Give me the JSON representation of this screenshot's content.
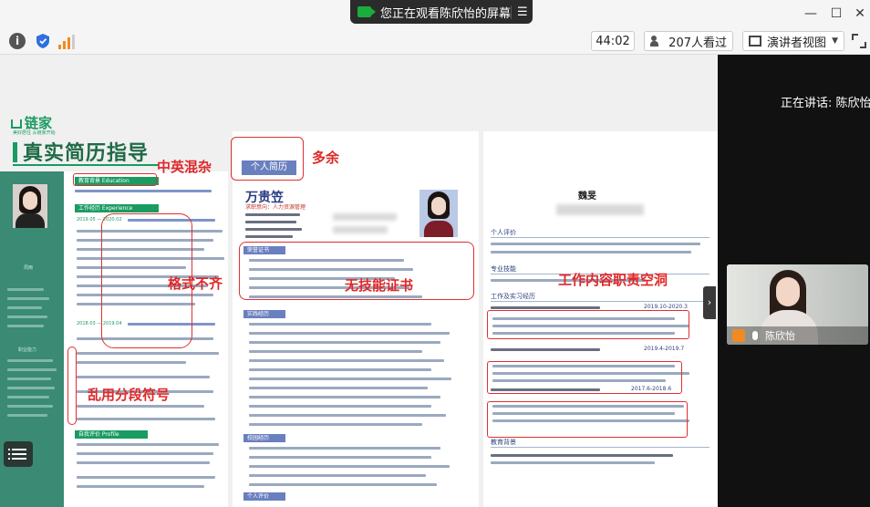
{
  "titlebar": {
    "share_status": "您正在观看陈欣怡的屏幕",
    "menu_glyph": "☰",
    "minimize_glyph": "—",
    "maximize_glyph": "☐",
    "close_glyph": "✕"
  },
  "toolbar": {
    "info_glyph": "i",
    "timer": "44:02",
    "viewers": "207人看过",
    "view_mode": "演讲者视图",
    "view_chevron": "▼"
  },
  "speaker": {
    "label": "正在讲话: 陈欣怡;",
    "camera_name": "陈欣怡"
  },
  "document": {
    "brand": "链家",
    "brand_sub": "美好居住 从链家开始",
    "title": "真实简历指导",
    "left_resume": {
      "section_education": "教育背景  Education",
      "section_work": "工作经历  Experience",
      "section_profile": "自我评价  Profile",
      "date_1": "2019.05 — 2020.02",
      "date_2": "2018.03 — 2019.04",
      "name": "周雨",
      "side_heading": "职业能力"
    },
    "middle_resume": {
      "header": "个人简历",
      "name": "万贵笠",
      "subtitle": "求职意向：人力资源管理",
      "sections": [
        "荣誉证书",
        "实践经历",
        "校园经历",
        "个人评价"
      ]
    },
    "right_resume": {
      "name": "魏旻",
      "labels": [
        "个人评价",
        "专业技能",
        "工作及实习经历",
        "教育背景"
      ],
      "dates": [
        "2019.10-2020.3",
        "2019.4-2019.7",
        "2017.6-2018.6"
      ]
    }
  },
  "annotations": {
    "mixed_language": "中英混杂",
    "redundant": "多余",
    "no_skill_cert": "无技能证书",
    "format_misaligned": "格式不齐",
    "empty_job_duties": "工作内容职责空洞",
    "random_segment_symbols": "乱用分段符号"
  },
  "colors": {
    "brand_green": "#1a9b62",
    "annotation_red": "#e02828",
    "sidebar_teal": "#3a8a74",
    "resume_blue": "#6a7fbf"
  }
}
